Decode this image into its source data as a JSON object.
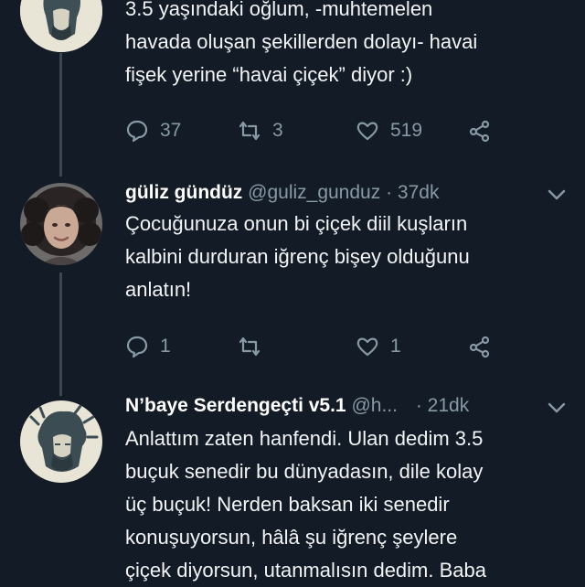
{
  "colors": {
    "background": "#131c26",
    "text": "#f2f4f6",
    "muted": "#8899a6",
    "thread_line": "#3a4652"
  },
  "tweet1": {
    "lines": [
      "3.5 yaşındaki oğlum, -muhtemelen",
      "havada oluşan şekillerden dolayı- havai",
      "fişek yerine “havai çiçek” diyor :)"
    ],
    "actions": {
      "reply_icon": "reply-icon",
      "replies": "37",
      "retweets": "3",
      "likes": "519"
    }
  },
  "tweet2": {
    "name": "güliz gündüz",
    "handle": "@guliz_gunduz",
    "separator": "·",
    "time": "37dk",
    "lines": [
      "Çocuğunuza onun bi çiçek diil kuşların",
      "kalbini durduran iğrenç bişey olduğunu",
      "anlatın!"
    ],
    "actions": {
      "replies": "1",
      "retweets": "",
      "likes": "1"
    }
  },
  "tweet3": {
    "name": "N’baye Serdengeçti v5.1",
    "handle": "@h...",
    "separator": "·",
    "time": "21dk",
    "lines": [
      "Anlattım zaten hanfendi. Ulan dedim 3.5",
      "buçuk senedir bu dünyadasın, dile kolay",
      "üç buçuk! Nerden baksan iki senedir",
      "konuşuyorsun, hâlâ şu iğrenç şeylere",
      "çiçek diyorsun, utanmalısın dedim. Baba"
    ]
  }
}
